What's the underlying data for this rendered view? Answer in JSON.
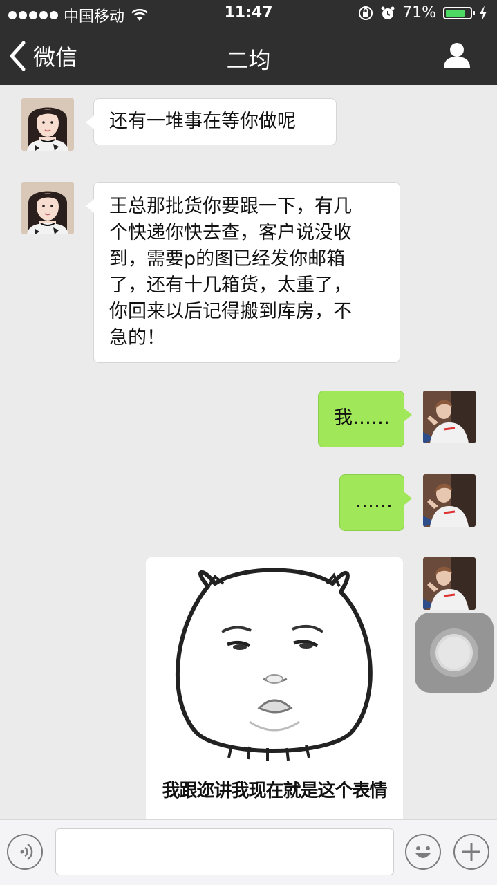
{
  "status_bar": {
    "carrier": "中国移动",
    "time": "11:47",
    "battery": "71%",
    "battery_level": 0.71
  },
  "nav": {
    "back_label": "微信",
    "title": "二均"
  },
  "messages": [
    {
      "side": "in",
      "text_lines": [
        "还有一堆事在等你做呢"
      ]
    },
    {
      "side": "in",
      "text_lines": [
        "王总那批货你要跟一下，有几",
        "个快递你快去查，客户说没收",
        "到，需要p的图已经发你邮箱",
        "了，还有十几箱货，太重了，",
        "你回来以后记得搬到库房，不",
        "急的！"
      ]
    },
    {
      "side": "out",
      "text_lines": [
        "我……"
      ]
    },
    {
      "side": "out",
      "text_lines": [
        "……"
      ]
    }
  ],
  "sticker": {
    "caption": "我跟迩讲我现在就是这个表情"
  },
  "input": {
    "value": ""
  },
  "icons": {
    "voice": "voice-icon",
    "emoji": "emoji-icon",
    "plus": "plus-icon",
    "profile": "profile-icon",
    "back": "chevron-left-icon"
  }
}
